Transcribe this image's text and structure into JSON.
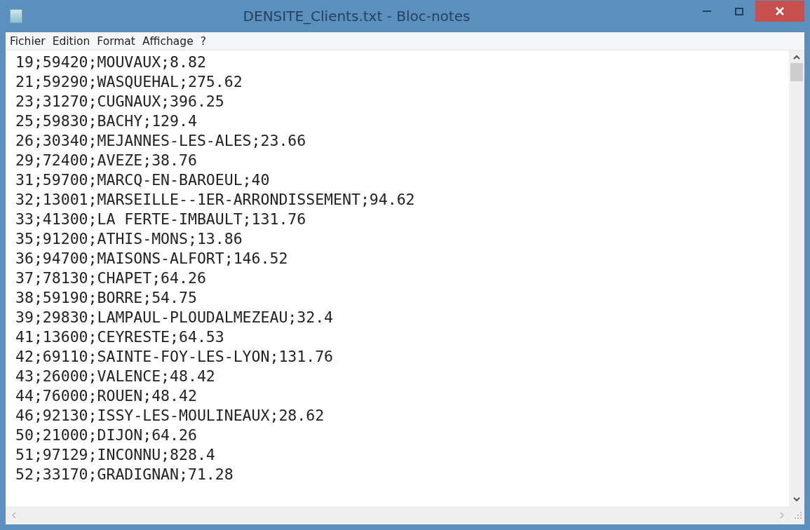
{
  "window": {
    "title": "DENSITE_Clients.txt - Bloc-notes"
  },
  "menu": [
    "Fichier",
    "Edition",
    "Format",
    "Affichage",
    "?"
  ],
  "lines": [
    "19;59420;MOUVAUX;8.82",
    "21;59290;WASQUEHAL;275.62",
    "23;31270;CUGNAUX;396.25",
    "25;59830;BACHY;129.4",
    "26;30340;MEJANNES-LES-ALES;23.66",
    "29;72400;AVEZE;38.76",
    "31;59700;MARCQ-EN-BAROEUL;40",
    "32;13001;MARSEILLE--1ER-ARRONDISSEMENT;94.62",
    "33;41300;LA FERTE-IMBAULT;131.76",
    "35;91200;ATHIS-MONS;13.86",
    "36;94700;MAISONS-ALFORT;146.52",
    "37;78130;CHAPET;64.26",
    "38;59190;BORRE;54.75",
    "39;29830;LAMPAUL-PLOUDALMEZEAU;32.4",
    "41;13600;CEYRESTE;64.53",
    "42;69110;SAINTE-FOY-LES-LYON;131.76",
    "43;26000;VALENCE;48.42",
    "44;76000;ROUEN;48.42",
    "46;92130;ISSY-LES-MOULINEAUX;28.62",
    "50;21000;DIJON;64.26",
    "51;97129;INCONNU;828.4",
    "52;33170;GRADIGNAN;71.28"
  ]
}
